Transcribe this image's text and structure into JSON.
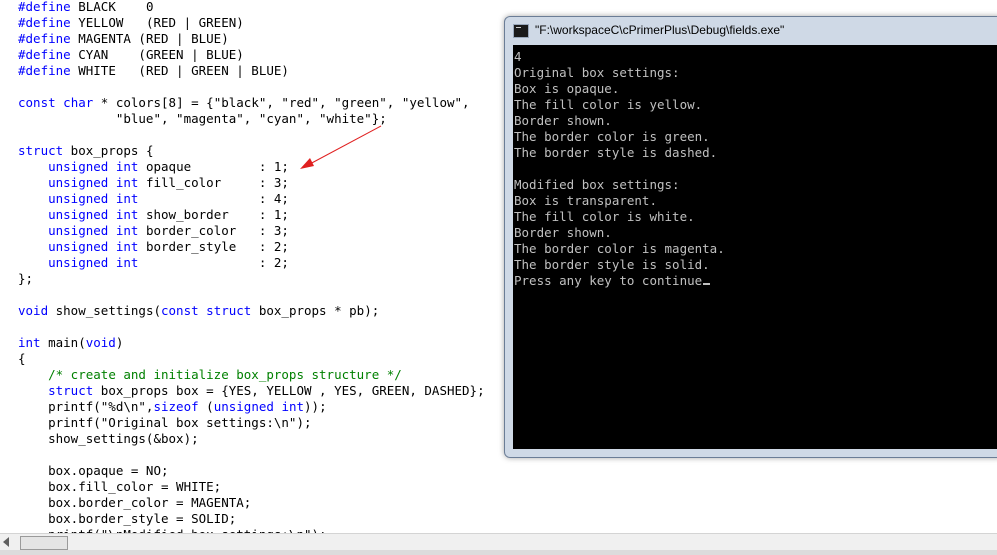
{
  "editor": {
    "lines": [
      [
        [
          "kw",
          "#define"
        ],
        [
          "t",
          " BLACK    0"
        ]
      ],
      [
        [
          "kw",
          "#define"
        ],
        [
          "t",
          " YELLOW   (RED | GREEN)"
        ]
      ],
      [
        [
          "kw",
          "#define"
        ],
        [
          "t",
          " MAGENTA (RED | BLUE)"
        ]
      ],
      [
        [
          "kw",
          "#define"
        ],
        [
          "t",
          " CYAN    (GREEN | BLUE)"
        ]
      ],
      [
        [
          "kw",
          "#define"
        ],
        [
          "t",
          " WHITE   (RED | GREEN | BLUE)"
        ]
      ],
      [],
      [
        [
          "kw",
          "const"
        ],
        [
          "t",
          " "
        ],
        [
          "kw",
          "char"
        ],
        [
          "t",
          " * colors[8] = {\"black\", \"red\", \"green\", \"yellow\","
        ]
      ],
      [
        [
          "t",
          "             \"blue\", \"magenta\", \"cyan\", \"white\"};"
        ]
      ],
      [],
      [
        [
          "kw",
          "struct"
        ],
        [
          "t",
          " box_props {"
        ]
      ],
      [
        [
          "t",
          "    "
        ],
        [
          "kw",
          "unsigned"
        ],
        [
          "t",
          " "
        ],
        [
          "kw",
          "int"
        ],
        [
          "t",
          " opaque         : 1;"
        ]
      ],
      [
        [
          "t",
          "    "
        ],
        [
          "kw",
          "unsigned"
        ],
        [
          "t",
          " "
        ],
        [
          "kw",
          "int"
        ],
        [
          "t",
          " fill_color     : 3;"
        ]
      ],
      [
        [
          "t",
          "    "
        ],
        [
          "kw",
          "unsigned"
        ],
        [
          "t",
          " "
        ],
        [
          "kw",
          "int"
        ],
        [
          "t",
          "                : 4;"
        ]
      ],
      [
        [
          "t",
          "    "
        ],
        [
          "kw",
          "unsigned"
        ],
        [
          "t",
          " "
        ],
        [
          "kw",
          "int"
        ],
        [
          "t",
          " show_border    : 1;"
        ]
      ],
      [
        [
          "t",
          "    "
        ],
        [
          "kw",
          "unsigned"
        ],
        [
          "t",
          " "
        ],
        [
          "kw",
          "int"
        ],
        [
          "t",
          " border_color   : 3;"
        ]
      ],
      [
        [
          "t",
          "    "
        ],
        [
          "kw",
          "unsigned"
        ],
        [
          "t",
          " "
        ],
        [
          "kw",
          "int"
        ],
        [
          "t",
          " border_style   : 2;"
        ]
      ],
      [
        [
          "t",
          "    "
        ],
        [
          "kw",
          "unsigned"
        ],
        [
          "t",
          " "
        ],
        [
          "kw",
          "int"
        ],
        [
          "t",
          "                : 2;"
        ]
      ],
      [
        [
          "t",
          "};"
        ]
      ],
      [],
      [
        [
          "kw",
          "void"
        ],
        [
          "t",
          " show_settings("
        ],
        [
          "kw",
          "const"
        ],
        [
          "t",
          " "
        ],
        [
          "kw",
          "struct"
        ],
        [
          "t",
          " box_props * pb);"
        ]
      ],
      [],
      [
        [
          "kw",
          "int"
        ],
        [
          "t",
          " main("
        ],
        [
          "kw",
          "void"
        ],
        [
          "t",
          ")"
        ]
      ],
      [
        [
          "t",
          "{"
        ]
      ],
      [
        [
          "t",
          "    "
        ],
        [
          "cm",
          "/* create and initialize box_props structure */"
        ]
      ],
      [
        [
          "t",
          "    "
        ],
        [
          "kw",
          "struct"
        ],
        [
          "t",
          " box_props box = {YES, YELLOW , YES, GREEN, DASHED};"
        ]
      ],
      [
        [
          "t",
          "    printf(\"%d\\n\","
        ],
        [
          "kw",
          "sizeof"
        ],
        [
          "t",
          " ("
        ],
        [
          "kw",
          "unsigned"
        ],
        [
          "t",
          " "
        ],
        [
          "kw",
          "int"
        ],
        [
          "t",
          "));"
        ]
      ],
      [
        [
          "t",
          "    printf(\"Original box settings:\\n\");"
        ]
      ],
      [
        [
          "t",
          "    show_settings(&box);"
        ]
      ],
      [],
      [
        [
          "t",
          "    box.opaque = NO;"
        ]
      ],
      [
        [
          "t",
          "    box.fill_color = WHITE;"
        ]
      ],
      [
        [
          "t",
          "    box.border_color = MAGENTA;"
        ]
      ],
      [
        [
          "t",
          "    box.border_style = SOLID;"
        ]
      ],
      [
        [
          "t",
          "    printf(\"\\nModified box settings:\\n\");"
        ]
      ]
    ]
  },
  "console": {
    "title": "\"F:\\workspaceC\\cPrimerPlus\\Debug\\fields.exe\"",
    "lines": [
      "4",
      "Original box settings:",
      "Box is opaque.",
      "The fill color is yellow.",
      "Border shown.",
      "The border color is green.",
      "The border style is dashed.",
      "",
      "Modified box settings:",
      "Box is transparent.",
      "The fill color is white.",
      "Border shown.",
      "The border color is magenta.",
      "The border style is solid.",
      "Press any key to continue"
    ]
  },
  "colors": {
    "keyword": "#0000ff",
    "comment": "#008000",
    "annotation_arrow": "#e02020",
    "console_text": "#c0c0c0",
    "console_bg": "#000000"
  },
  "icons": {
    "console_icon": "console-window-icon",
    "scroll_left": "scroll-left-arrow-icon"
  }
}
